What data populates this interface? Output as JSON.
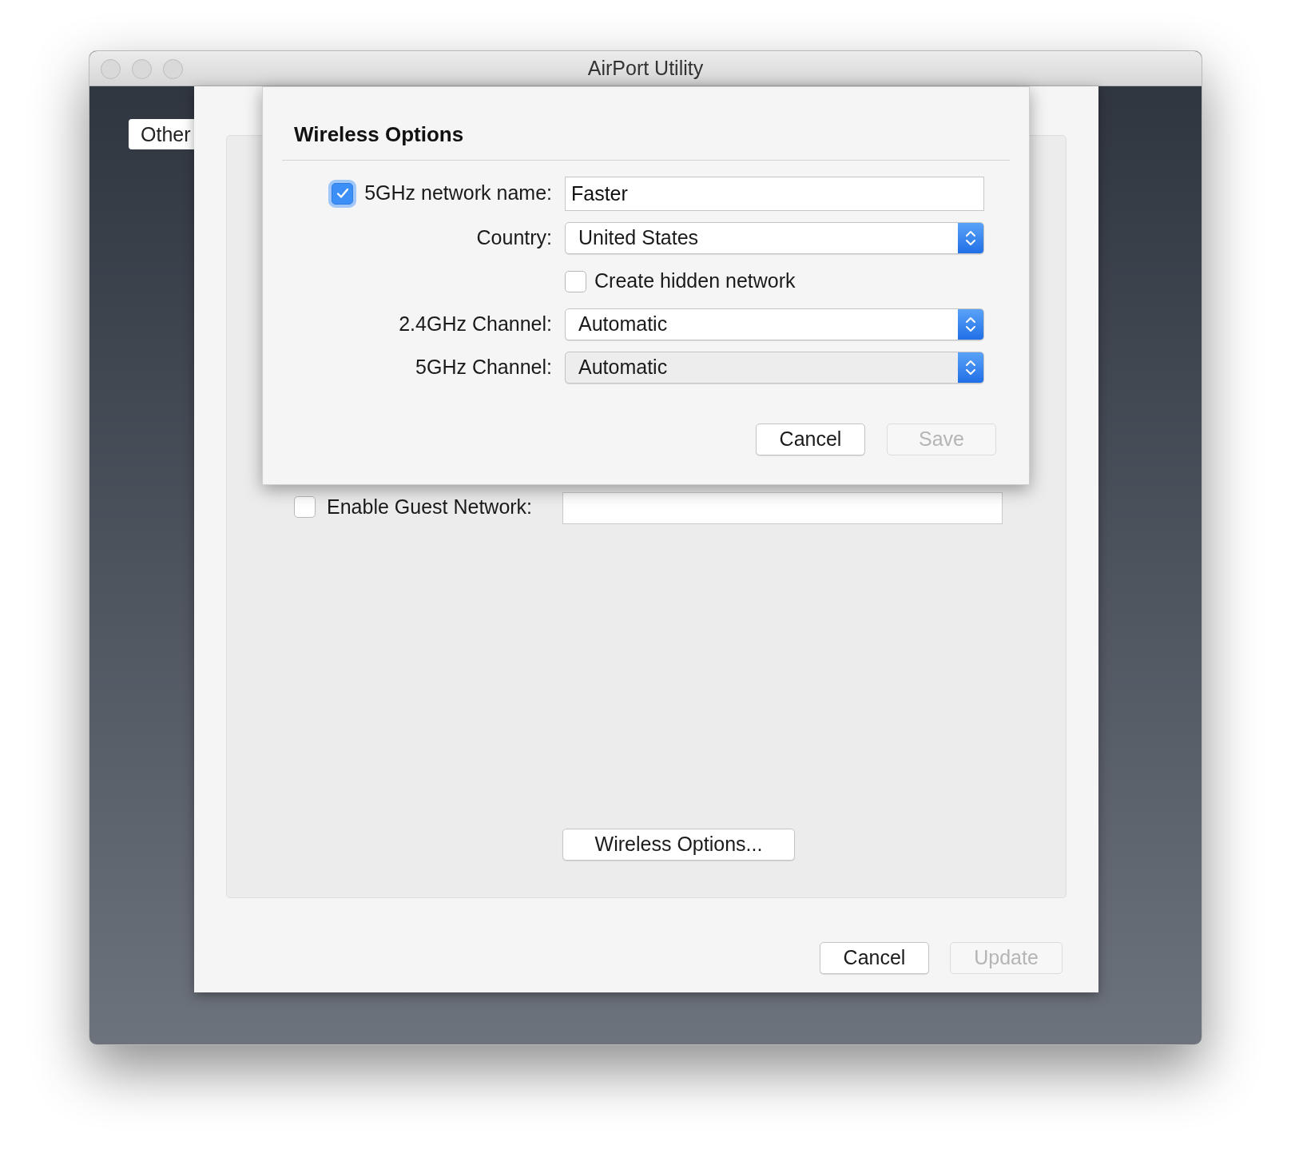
{
  "window": {
    "title": "AirPort Utility"
  },
  "background_tab": {
    "label": "Other"
  },
  "sheet": {
    "guest_network": {
      "label": "Enable Guest Network:",
      "checked": false
    },
    "options_button": "Wireless Options...",
    "buttons": [
      {
        "label": "Cancel",
        "disabled": false
      },
      {
        "label": "Update",
        "disabled": true
      }
    ]
  },
  "dialog": {
    "title": "Wireless Options",
    "rows": [
      {
        "kind": "checkbox-field",
        "label": "5GHz network name:",
        "checked": true,
        "value": "Faster"
      },
      {
        "kind": "popup",
        "label": "Country:",
        "value": "United States"
      },
      {
        "kind": "checkbox",
        "label": "Create hidden network",
        "checked": false
      },
      {
        "kind": "popup",
        "label": "2.4GHz Channel:",
        "value": "Automatic"
      },
      {
        "kind": "popup",
        "label": "5GHz Channel:",
        "value": "Automatic"
      }
    ],
    "buttons": [
      {
        "label": "Cancel",
        "disabled": false
      },
      {
        "label": "Save",
        "disabled": true
      }
    ]
  }
}
